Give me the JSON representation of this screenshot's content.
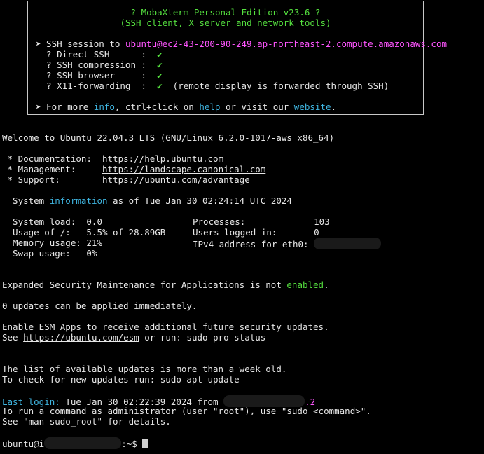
{
  "banner": {
    "title": "? MobaXterm Personal Edition v23.6 ?",
    "subtitle": "(SSH client, X server and network tools)",
    "session_prefix": "➤ SSH session to ",
    "session_host": "ubuntu@ec2-43-200-90-249.ap-northeast-2.compute.amazonaws.com",
    "features": [
      {
        "label": "  ? Direct SSH      :  ",
        "check": "✔",
        "note": ""
      },
      {
        "label": "  ? SSH compression :  ",
        "check": "✔",
        "note": ""
      },
      {
        "label": "  ? SSH-browser     :  ",
        "check": "✔",
        "note": ""
      },
      {
        "label": "  ? X11-forwarding  :  ",
        "check": "✔",
        "note": "  (remote display is forwarded through SSH)"
      }
    ],
    "more_prefix": "➤ For more ",
    "more_info": "info",
    "more_mid": ", ctrl+click on ",
    "more_help": "help",
    "more_mid2": " or visit our ",
    "more_website": "website",
    "more_end": "."
  },
  "welcome": "Welcome to Ubuntu 22.04.3 LTS (GNU/Linux 6.2.0-1017-aws x86_64)",
  "docs": [
    {
      "label": " * Documentation:  ",
      "url": "https://help.ubuntu.com"
    },
    {
      "label": " * Management:     ",
      "url": "https://landscape.canonical.com"
    },
    {
      "label": " * Support:        ",
      "url": "https://ubuntu.com/advantage"
    }
  ],
  "sysinfo": {
    "prefix": "  System ",
    "word": "information",
    "suffix": " as of Tue Jan 30 02:24:14 UTC 2024"
  },
  "stats": [
    {
      "left": "  System load:  0.0",
      "right": "Processes:             103"
    },
    {
      "left": "  Usage of /:   5.5% of 28.89GB",
      "right": "Users logged in:       0"
    },
    {
      "left": "  Memory usage: 21%",
      "right": "IPv4 address for eth0:"
    },
    {
      "left": "  Swap usage:   0%",
      "right": ""
    }
  ],
  "esm_line": {
    "prefix": "Expanded Security Maintenance for Applications is not ",
    "word": "enabled",
    "suffix": "."
  },
  "updates_line": "0 updates can be applied immediately.",
  "esm_apps_line": "Enable ESM Apps to receive additional future security updates.",
  "esm_see": {
    "prefix": "See ",
    "url": "https://ubuntu.com/esm",
    "suffix": " or run: sudo pro status"
  },
  "old_list_line": "The list of available updates is more than a week old.",
  "check_updates_line": "To check for new updates run: sudo apt update",
  "last_login": {
    "label": "Last login:",
    "text": " Tue Jan 30 02:22:39 2024 from ",
    "tail": ".2"
  },
  "sudo_line1": "To run a command as administrator (user \"root\"), use \"sudo <command>\".",
  "sudo_line2": "See \"man sudo_root\" for details.",
  "prompt": {
    "prefix": "ubuntu@i",
    "suffix": ":~$ "
  },
  "colors": {
    "green": "#55e03f",
    "magenta": "#ff55ff",
    "cyan": "#3fb5e0",
    "background": "#000000"
  }
}
